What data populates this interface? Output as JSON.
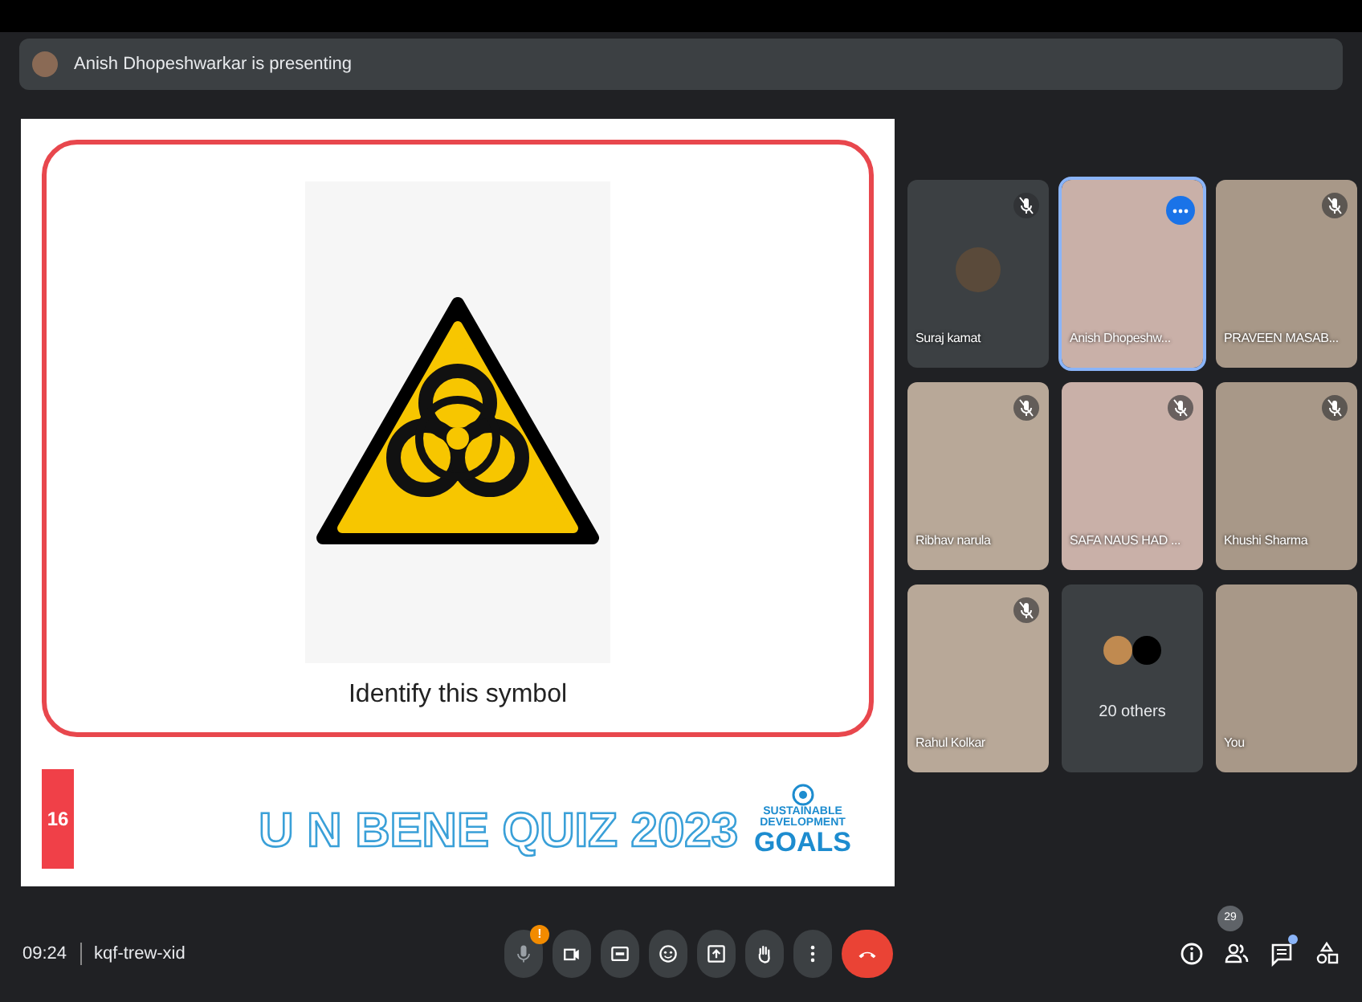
{
  "presenter_banner": {
    "text": "Anish Dhopeshwarkar is presenting"
  },
  "slide": {
    "caption": "Identify this symbol",
    "slide_number": "16",
    "quiz_title": "U N BENE QUIZ 2023",
    "sdg_logo": [
      "SUSTAINABLE",
      "DEVELOPMENT",
      "GOALS"
    ]
  },
  "tiles": [
    {
      "kind": "avatar",
      "name": "Suraj kamat",
      "muted": true,
      "highlighted": false
    },
    {
      "kind": "video",
      "name": "Anish Dhopeshw...",
      "muted": false,
      "highlighted": true
    },
    {
      "kind": "video",
      "name": "PRAVEEN MASAB...",
      "muted": true,
      "highlighted": false
    },
    {
      "kind": "video",
      "name": "Ribhav narula",
      "muted": true,
      "highlighted": false
    },
    {
      "kind": "video",
      "name": "SAFA NAUS HAD ...",
      "muted": true,
      "highlighted": false
    },
    {
      "kind": "video",
      "name": "Khushi Sharma",
      "muted": true,
      "highlighted": false
    },
    {
      "kind": "video",
      "name": "Rahul Kolkar",
      "muted": true,
      "highlighted": false
    },
    {
      "kind": "others",
      "name": "20 others",
      "muted": false,
      "highlighted": false
    },
    {
      "kind": "video",
      "name": "You",
      "muted": false,
      "highlighted": false
    }
  ],
  "bottom_bar": {
    "time": "09:24",
    "meeting_code": "kqf-trew-xid",
    "controls": [
      {
        "kind": "mic",
        "badge": "!"
      },
      {
        "kind": "camera"
      },
      {
        "kind": "captions"
      },
      {
        "kind": "emoji"
      },
      {
        "kind": "present"
      },
      {
        "kind": "hand"
      },
      {
        "kind": "more"
      },
      {
        "kind": "hangup"
      }
    ],
    "side_controls": [
      {
        "kind": "info"
      },
      {
        "kind": "people",
        "count": "29"
      },
      {
        "kind": "chat",
        "unread": true
      },
      {
        "kind": "activities"
      }
    ]
  }
}
